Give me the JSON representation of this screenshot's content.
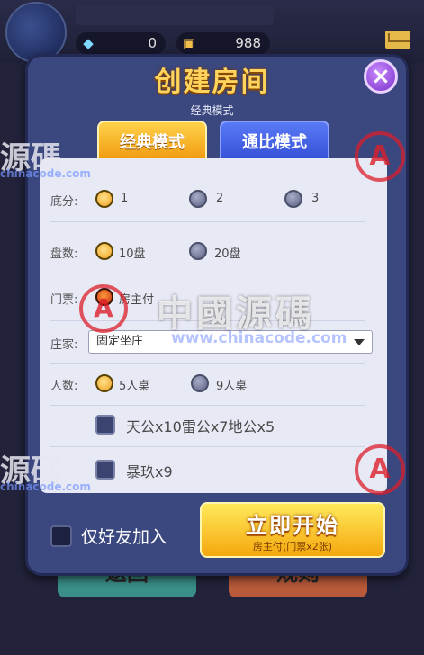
{
  "topbar": {
    "diamonds": "0",
    "cards": "988",
    "diamond_icon": "diamond-icon",
    "card_icon": "ticket-icon",
    "mail_icon": "mail-icon"
  },
  "background_buttons": {
    "back_label": "返回",
    "rules_label": "规则"
  },
  "dialog": {
    "title": "创建房间",
    "subtitle": "经典模式",
    "close_icon": "close-icon",
    "tabs": [
      {
        "label": "经典模式",
        "active": true
      },
      {
        "label": "通比模式",
        "active": false
      }
    ],
    "base_score": {
      "label": "底分:",
      "options": [
        "1",
        "2",
        "3"
      ],
      "selected": "1"
    },
    "rounds": {
      "label": "盘数:",
      "options": [
        "10盘",
        "20盘"
      ],
      "selected": "10盘"
    },
    "ticket": {
      "label": "门票:",
      "options": [
        "房主付"
      ],
      "selected": "房主付"
    },
    "banker": {
      "label": "庄家:",
      "value": "固定坐庄"
    },
    "players": {
      "label": "人数:",
      "options": [
        "5人桌",
        "9人桌"
      ],
      "selected": "5人桌"
    },
    "checkboxes": [
      {
        "label": "天公x10雷公x7地公x5",
        "checked": false
      },
      {
        "label": "暴玖x9",
        "checked": false
      }
    ],
    "friends_only": {
      "label": "仅好友加入",
      "checked": false
    },
    "start_button": {
      "label": "立即开始",
      "sub_label": "房主付(门票x2张)"
    }
  },
  "watermark": {
    "main": "中國源碼",
    "url": "www.chinacode.com",
    "side": "源碼",
    "side_url": "chinacode.com",
    "logo_letter": "A"
  },
  "colors": {
    "accent_gold": "#ffd35c",
    "panel": "#3b4880",
    "content_bg": "#e7e9f5",
    "tab_active": "#f5a80e",
    "tab_inactive": "#3450d8"
  }
}
